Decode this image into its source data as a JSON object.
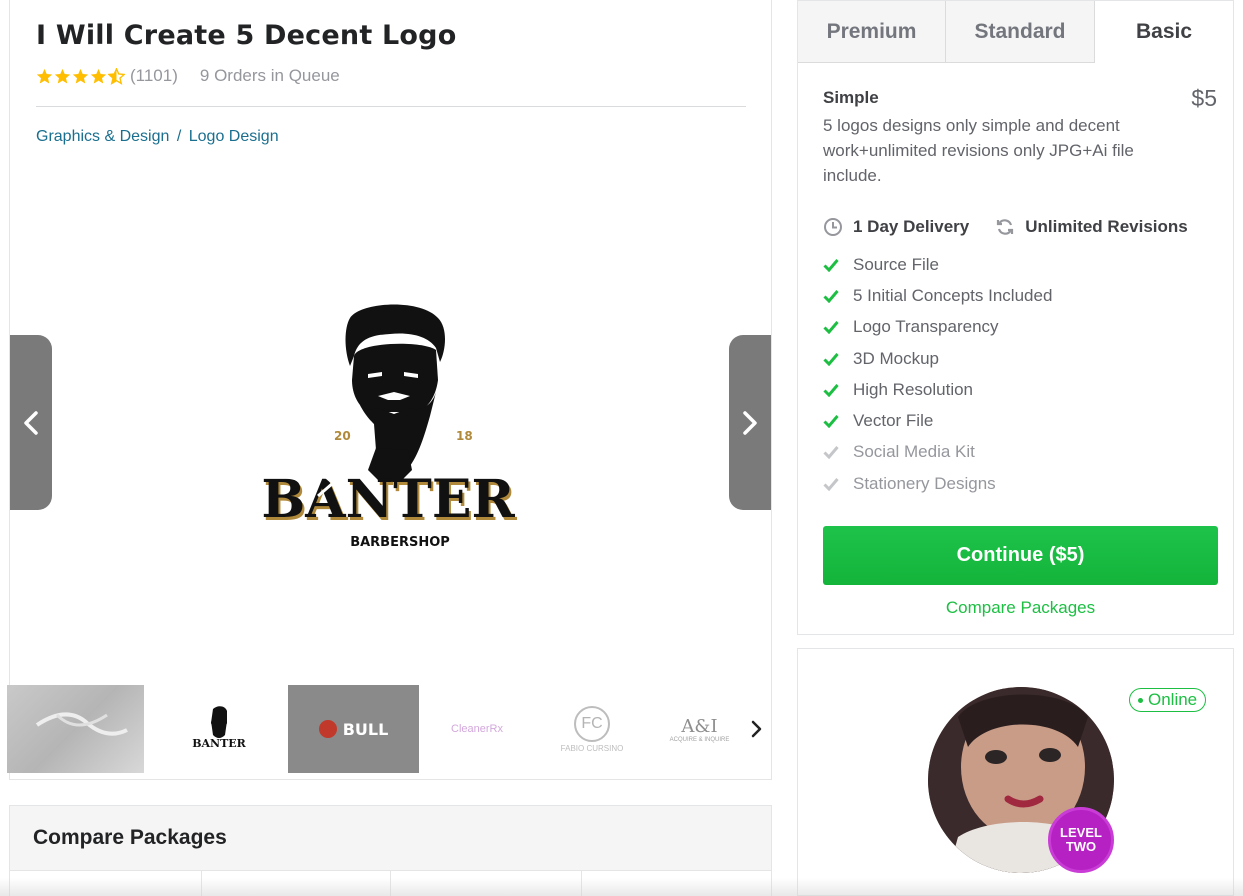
{
  "gig": {
    "title": "I Will Create 5 Decent Logo",
    "rating_stars": 4.5,
    "rating_count": "(1101)",
    "orders_in_queue": "9 Orders in Queue",
    "breadcrumb": {
      "category": "Graphics & Design",
      "separator": "/",
      "subcategory": "Logo Design"
    }
  },
  "gallery": {
    "main_image": {
      "year_left": "20",
      "year_right": "18",
      "brand": "BANTER",
      "tagline": "BARBERSHOP"
    },
    "prev_icon": "chevron-left-icon",
    "next_icon": "chevron-right-icon",
    "thumbnails": [
      {
        "label": ""
      },
      {
        "label": "BANTER"
      },
      {
        "label": "BULL"
      },
      {
        "label": "CleanerRx"
      },
      {
        "label": "FC",
        "sub": "FABIO CURSINO"
      },
      {
        "label": "A&I",
        "sub": "ACQUIRE & INQUIRE"
      }
    ]
  },
  "compare": {
    "title": "Compare Packages"
  },
  "packages": {
    "tabs": [
      {
        "label": "Premium"
      },
      {
        "label": "Standard"
      },
      {
        "label": "Basic"
      }
    ],
    "selected": {
      "name": "Simple",
      "price": "$5",
      "description": "5 logos designs only simple and decent work+unlimited revisions only JPG+Ai file include.",
      "delivery": "1 Day Delivery",
      "revisions": "Unlimited Revisions",
      "features": [
        {
          "label": "Source File",
          "included": true
        },
        {
          "label": "5 Initial Concepts Included",
          "included": true
        },
        {
          "label": "Logo Transparency",
          "included": true
        },
        {
          "label": "3D Mockup",
          "included": true
        },
        {
          "label": "High Resolution",
          "included": true
        },
        {
          "label": "Vector File",
          "included": true
        },
        {
          "label": "Social Media Kit",
          "included": false
        },
        {
          "label": "Stationery Designs",
          "included": false
        }
      ],
      "continue_label": "Continue ($5)",
      "compare_link": "Compare Packages"
    }
  },
  "seller": {
    "status": "Online",
    "level_line1": "LEVEL",
    "level_line2": "TWO"
  },
  "colors": {
    "accent_green": "#1dbf43",
    "star_gold": "#ffbe00",
    "link_blue": "#1a6f8f",
    "level_purple": "#b621c4"
  }
}
